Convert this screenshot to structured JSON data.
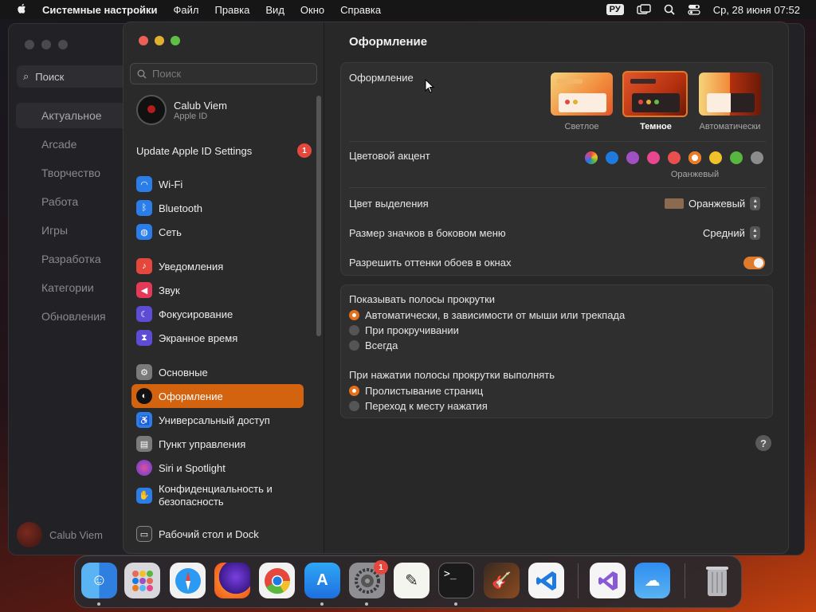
{
  "menubar": {
    "app": "Системные настройки",
    "items": [
      "Файл",
      "Правка",
      "Вид",
      "Окно",
      "Справка"
    ],
    "input_lang": "РУ",
    "clock": "Ср, 28 июня  07:52"
  },
  "bg_window": {
    "search_placeholder": "Поиск",
    "nav": [
      "Актуальное",
      "Arcade",
      "Творчество",
      "Работа",
      "Игры",
      "Разработка",
      "Категории",
      "Обновления"
    ],
    "user": "Calub Viem"
  },
  "sidebar": {
    "search_placeholder": "Поиск",
    "account": {
      "name": "Calub Viem",
      "sub": "Apple ID"
    },
    "update": {
      "label": "Update Apple ID Settings",
      "badge": "1"
    },
    "items": [
      {
        "label": "Wi-Fi",
        "icon": "wifi-icon",
        "color": "#2b7de9"
      },
      {
        "label": "Bluetooth",
        "icon": "bluetooth-icon",
        "color": "#2b7de9"
      },
      {
        "label": "Сеть",
        "icon": "globe-icon",
        "color": "#2b7de9"
      },
      {
        "label": "Уведомления",
        "icon": "bell-icon",
        "color": "#e5473d"
      },
      {
        "label": "Звук",
        "icon": "speaker-icon",
        "color": "#e5395a"
      },
      {
        "label": "Фокусирование",
        "icon": "moon-icon",
        "color": "#5e4bd6"
      },
      {
        "label": "Экранное время",
        "icon": "hourglass-icon",
        "color": "#5e4bd6"
      },
      {
        "label": "Основные",
        "icon": "gear-icon",
        "color": "#7a7a7a"
      },
      {
        "label": "Оформление",
        "icon": "appearance-icon",
        "color": "#111111"
      },
      {
        "label": "Универсальный доступ",
        "icon": "accessibility-icon",
        "color": "#2b7de9"
      },
      {
        "label": "Пункт управления",
        "icon": "control-center-icon",
        "color": "#7a7a7a"
      },
      {
        "label": "Siri и Spotlight",
        "icon": "siri-icon",
        "color": "#9b3fd1"
      },
      {
        "label": "Конфиденциальность и безопасность",
        "icon": "hand-icon",
        "color": "#2b7de9"
      },
      {
        "label": "Рабочий стол и Dock",
        "icon": "dock-icon",
        "color": "#333333"
      }
    ]
  },
  "content": {
    "title": "Оформление",
    "appearance": {
      "label": "Оформление",
      "options": [
        "Светлое",
        "Темное",
        "Автоматически"
      ],
      "selected": "Темное"
    },
    "accent": {
      "label": "Цветовой акцент",
      "selected_name": "Оранжевый",
      "colors": [
        "multicolor",
        "#1f7ae0",
        "#a050c2",
        "#e8468f",
        "#ea4f4f",
        "#ea7b22",
        "#f1c12c",
        "#57b73e",
        "#8c8c8c"
      ]
    },
    "highlight": {
      "label": "Цвет выделения",
      "value": "Оранжевый",
      "swatch": "#8c6a4f"
    },
    "icon_size": {
      "label": "Размер значков в боковом меню",
      "value": "Средний"
    },
    "wallpaper_tint": {
      "label": "Разрешить оттенки обоев в окнах",
      "enabled": true
    },
    "scrollbars": {
      "label": "Показывать полосы прокрутки",
      "options": [
        "Автоматически, в зависимости от мыши или трекпада",
        "При прокручивании",
        "Всегда"
      ],
      "selected": 0
    },
    "click": {
      "label": "При нажатии полосы прокрутки выполнять",
      "options": [
        "Пролистывание страниц",
        "Переход к месту нажатия"
      ],
      "selected": 0
    },
    "help": "?"
  },
  "dock": {
    "apps": [
      "Finder",
      "Launchpad",
      "Safari",
      "Firefox",
      "Chrome",
      "App Store",
      "Системные настройки",
      "TextEdit",
      "Терминал",
      "GarageBand",
      "VS Code",
      "Visual Studio",
      "Погода",
      "Корзина"
    ],
    "settings_badge": "1"
  }
}
